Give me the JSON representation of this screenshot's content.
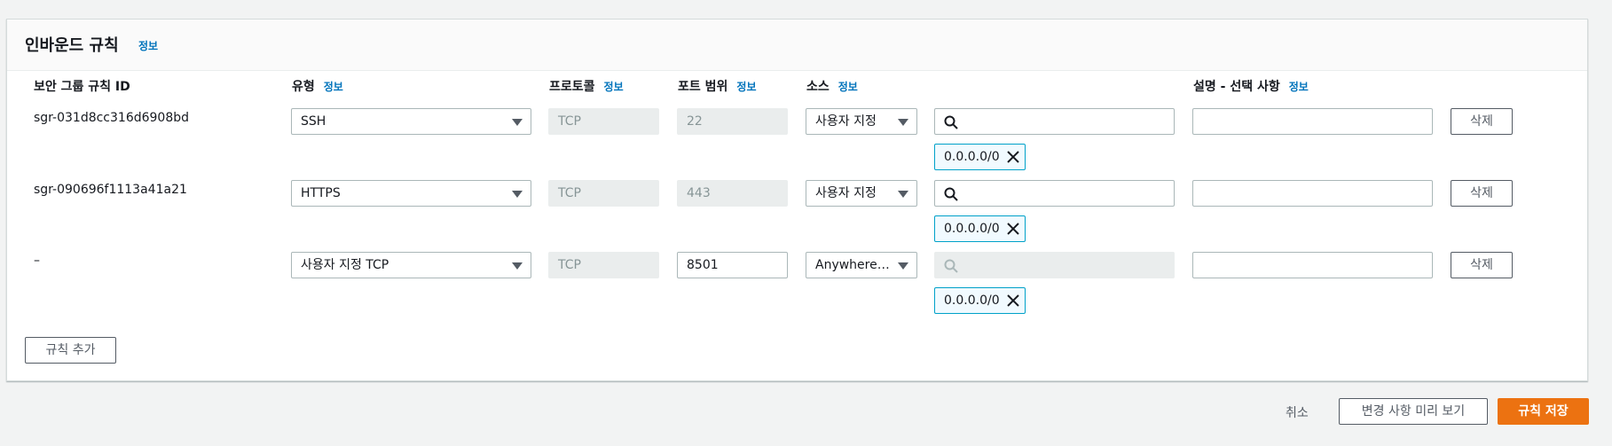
{
  "panel": {
    "title": "인바운드 규칙",
    "info": "정보"
  },
  "columns": {
    "rule_id": "보안 그룹 규칙 ID",
    "type": "유형",
    "protocol": "프로토콜",
    "port_range": "포트 범위",
    "source": "소스",
    "description": "설명 - 선택 사항",
    "info": "정보"
  },
  "rules": [
    {
      "id": "sgr-031d8cc316d6908bd",
      "type": "SSH",
      "protocol": "TCP",
      "port": "22",
      "source_type": "사용자 지정",
      "search_value": "",
      "token": "0.0.0.0/0",
      "description": "",
      "delete_label": "삭제"
    },
    {
      "id": "sgr-090696f1113a41a21",
      "type": "HTTPS",
      "protocol": "TCP",
      "port": "443",
      "source_type": "사용자 지정",
      "search_value": "",
      "token": "0.0.0.0/0",
      "description": "",
      "delete_label": "삭제"
    },
    {
      "id": "–",
      "type": "사용자 지정 TCP",
      "protocol": "TCP",
      "port": "8501",
      "source_type": "Anywhere-I...",
      "search_value": "",
      "token": "0.0.0.0/0",
      "description": "",
      "delete_label": "삭제"
    }
  ],
  "add_rule_label": "규칙 추가",
  "footer": {
    "cancel_label": "취소",
    "preview_label": "변경 사항 미리 보기",
    "save_label": "규칙 저장"
  },
  "colors": {
    "accent": "#ec7211",
    "link": "#0073bb",
    "token_border": "#00a1c9"
  }
}
